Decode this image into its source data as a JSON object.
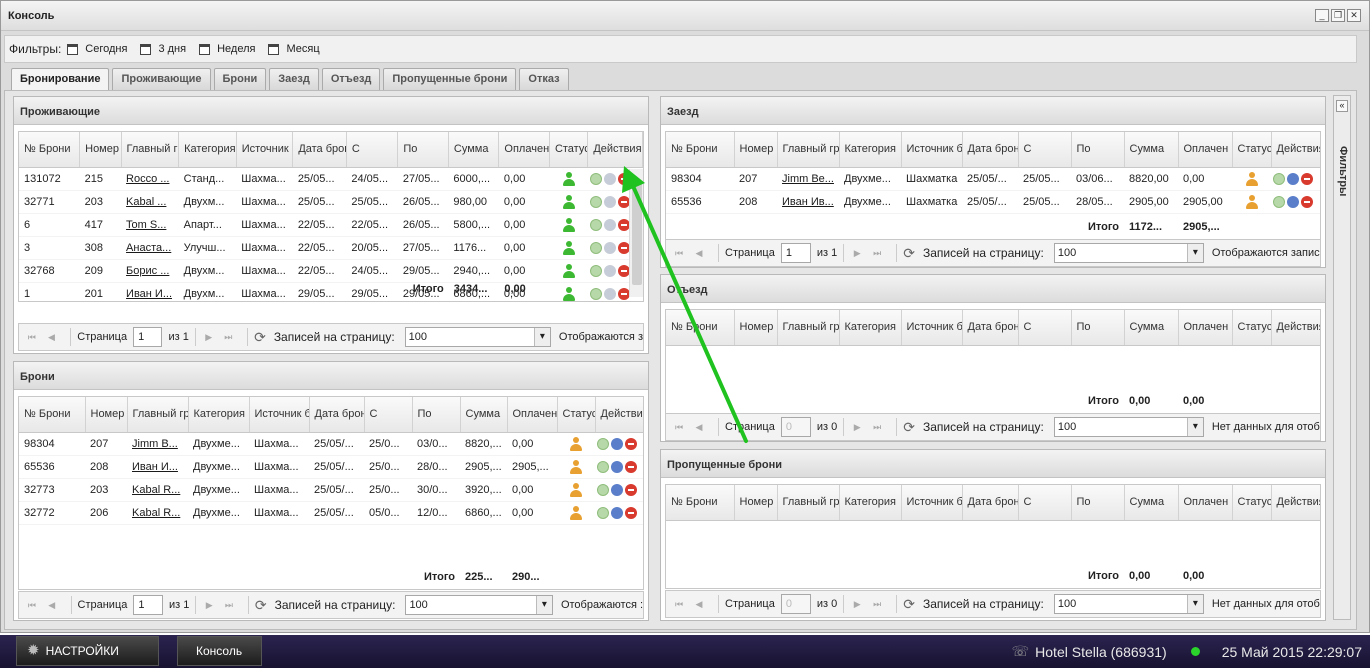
{
  "window": {
    "title": "Консоль"
  },
  "filters": {
    "label": "Фильтры:",
    "buttons": [
      "Сегодня",
      "3 дня",
      "Неделя",
      "Месяц"
    ]
  },
  "tabs": [
    "Бронирование",
    "Проживающие",
    "Брони",
    "Заезд",
    "Отъезд",
    "Пропущенные брони",
    "Отказ"
  ],
  "active_tab": "Бронирование",
  "sidebar": {
    "label": "Фильтры"
  },
  "pager_labels": {
    "page": "Страница",
    "per_page": "Записей на страницу:",
    "per_page_value": "100"
  },
  "panels": {
    "residents": {
      "title": "Проживающие",
      "columns": [
        "№ Брони",
        "Номер",
        "Главный г",
        "Категория",
        "Источник",
        "Дата бронирова",
        "С",
        "По",
        "Сумма",
        "Оплачен",
        "Статус",
        "Действия"
      ],
      "rows": [
        [
          "131072",
          "215",
          "Rocco ...",
          "Станд...",
          "Шахма...",
          "25/05...",
          "24/05...",
          "27/05...",
          "6000,...",
          "0,00"
        ],
        [
          "32771",
          "203",
          "Kabal ...",
          "Двухм...",
          "Шахма...",
          "25/05...",
          "25/05...",
          "26/05...",
          "980,00",
          "0,00"
        ],
        [
          "6",
          "417",
          "Tom S...",
          "Апарт...",
          "Шахма...",
          "22/05...",
          "22/05...",
          "26/05...",
          "5800,...",
          "0,00"
        ],
        [
          "3",
          "308",
          "Анаста...",
          "Улучш...",
          "Шахма...",
          "22/05...",
          "20/05...",
          "27/05...",
          "1176...",
          "0,00"
        ],
        [
          "32768",
          "209",
          "Борис ...",
          "Двухм...",
          "Шахма...",
          "22/05...",
          "24/05...",
          "29/05...",
          "2940,...",
          "0,00"
        ],
        [
          "1",
          "201",
          "Иван И...",
          "Двухм...",
          "Шахма...",
          "29/05...",
          "29/05...",
          "29/05...",
          "6860,...",
          "0,00"
        ]
      ],
      "total": {
        "label": "Итого",
        "sum": "3434...",
        "paid": "0,00"
      },
      "pager": {
        "page": "1",
        "of": "из 1",
        "status": "Отображаются з"
      }
    },
    "bookings": {
      "title": "Брони",
      "columns": [
        "№ Брони",
        "Номер",
        "Главный гр",
        "Категория",
        "Источник б",
        "Дата бронирова",
        "С",
        "По",
        "Сумма",
        "Оплачен",
        "Статус",
        "Действи"
      ],
      "rows": [
        [
          "98304",
          "207",
          "Jimm B...",
          "Двухме...",
          "Шахма...",
          "25/05/...",
          "25/0...",
          "03/0...",
          "8820,...",
          "0,00"
        ],
        [
          "65536",
          "208",
          "Иван И...",
          "Двухме...",
          "Шахма...",
          "25/05/...",
          "25/0...",
          "28/0...",
          "2905,...",
          "2905,..."
        ],
        [
          "32773",
          "203",
          "Kabal R...",
          "Двухме...",
          "Шахма...",
          "25/05/...",
          "25/0...",
          "30/0...",
          "3920,...",
          "0,00"
        ],
        [
          "32772",
          "206",
          "Kabal R...",
          "Двухме...",
          "Шахма...",
          "25/05/...",
          "05/0...",
          "12/0...",
          "6860,...",
          "0,00"
        ]
      ],
      "total": {
        "label": "Итого",
        "sum": "225...",
        "paid": "290..."
      },
      "pager": {
        "page": "1",
        "of": "из 1",
        "status": "Отображаются :"
      }
    },
    "checkin": {
      "title": "Заезд",
      "columns": [
        "№ Брони",
        "Номер",
        "Главный гр",
        "Категория",
        "Источник б",
        "Дата бронирова",
        "С",
        "По",
        "Сумма",
        "Оплачен",
        "Статус",
        "Действия"
      ],
      "rows": [
        [
          "98304",
          "207",
          "Jimm Be...",
          "Двухме...",
          "Шахматка",
          "25/05/...",
          "25/05...",
          "03/06...",
          "8820,00",
          "0,00"
        ],
        [
          "65536",
          "208",
          "Иван Ив...",
          "Двухме...",
          "Шахматка",
          "25/05/...",
          "25/05...",
          "28/05...",
          "2905,00",
          "2905,00"
        ]
      ],
      "total": {
        "label": "Итого",
        "sum": "1172...",
        "paid": "2905,..."
      },
      "pager": {
        "page": "1",
        "of": "из 1",
        "status": "Отображаются запис"
      }
    },
    "checkout": {
      "title": "Отъезд",
      "columns": [
        "№ Брони",
        "Номер",
        "Главный гр",
        "Категория",
        "Источник б",
        "Дата бронирова",
        "С",
        "По",
        "Сумма",
        "Оплачен",
        "Статус",
        "Действия"
      ],
      "rows": [],
      "total": {
        "label": "Итого",
        "sum": "0,00",
        "paid": "0,00"
      },
      "pager": {
        "page": "0",
        "of": "из 0",
        "status": "Нет данных для отоб"
      }
    },
    "missed": {
      "title": "Пропущенные брони",
      "columns": [
        "№ Брони",
        "Номер",
        "Главный гр",
        "Категория",
        "Источник б",
        "Дата бронирова",
        "С",
        "По",
        "Сумма",
        "Оплачен",
        "Статус",
        "Действия"
      ],
      "rows": [],
      "total": {
        "label": "Итого",
        "sum": "0,00",
        "paid": "0,00"
      },
      "pager": {
        "page": "0",
        "of": "из 0",
        "status": "Нет данных для отоб"
      }
    }
  },
  "taskbar": {
    "settings": "НАСТРОЙКИ",
    "console": "Консоль",
    "hotel": "Hotel Stella (686931)",
    "datetime": "25 Май 2015 22:29:07"
  },
  "colors": {
    "status_green": "#3db832",
    "status_orange": "#e8a030",
    "annotation_arrow": "#1fc21f"
  }
}
